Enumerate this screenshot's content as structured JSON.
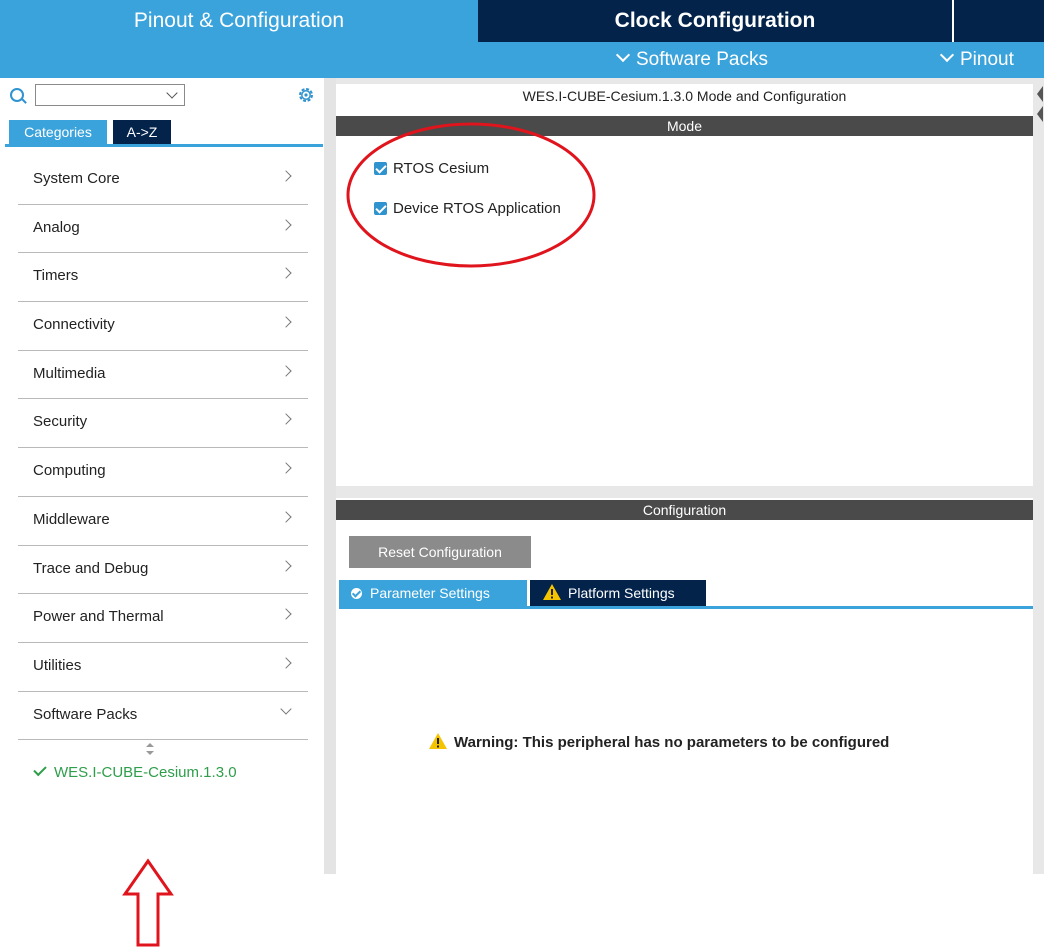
{
  "top_tabs": {
    "pinout_config": "Pinout & Configuration",
    "clock_config": "Clock Configuration"
  },
  "sub_bar": {
    "software_packs": "Software Packs",
    "pinout": "Pinout"
  },
  "sidebar": {
    "search_value": "",
    "tabs": {
      "categories": "Categories",
      "az": "A->Z"
    },
    "categories": [
      {
        "label": "System Core"
      },
      {
        "label": "Analog"
      },
      {
        "label": "Timers"
      },
      {
        "label": "Connectivity"
      },
      {
        "label": "Multimedia"
      },
      {
        "label": "Security"
      },
      {
        "label": "Computing"
      },
      {
        "label": "Middleware"
      },
      {
        "label": "Trace and Debug"
      },
      {
        "label": "Power and Thermal"
      },
      {
        "label": "Utilities"
      },
      {
        "label": "Software Packs"
      }
    ],
    "pack_item": "WES.I-CUBE-Cesium.1.3.0"
  },
  "mode_panel": {
    "title": "WES.I-CUBE-Cesium.1.3.0 Mode and Configuration",
    "section": "Mode",
    "checkboxes": [
      {
        "label": "RTOS Cesium",
        "checked": true
      },
      {
        "label": "Device RTOS Application",
        "checked": true
      }
    ]
  },
  "config_panel": {
    "section": "Configuration",
    "reset_button": "Reset Configuration",
    "tabs": {
      "parameter": "Parameter Settings",
      "platform": "Platform Settings"
    },
    "warning": "Warning: This peripheral has no parameters to be configured"
  },
  "colors": {
    "accent_blue": "#3ba3db",
    "dark_navy": "#03234b",
    "annotation_red": "#e0141c",
    "success_green": "#2e9e4a",
    "warning_yellow": "#f5c400"
  }
}
